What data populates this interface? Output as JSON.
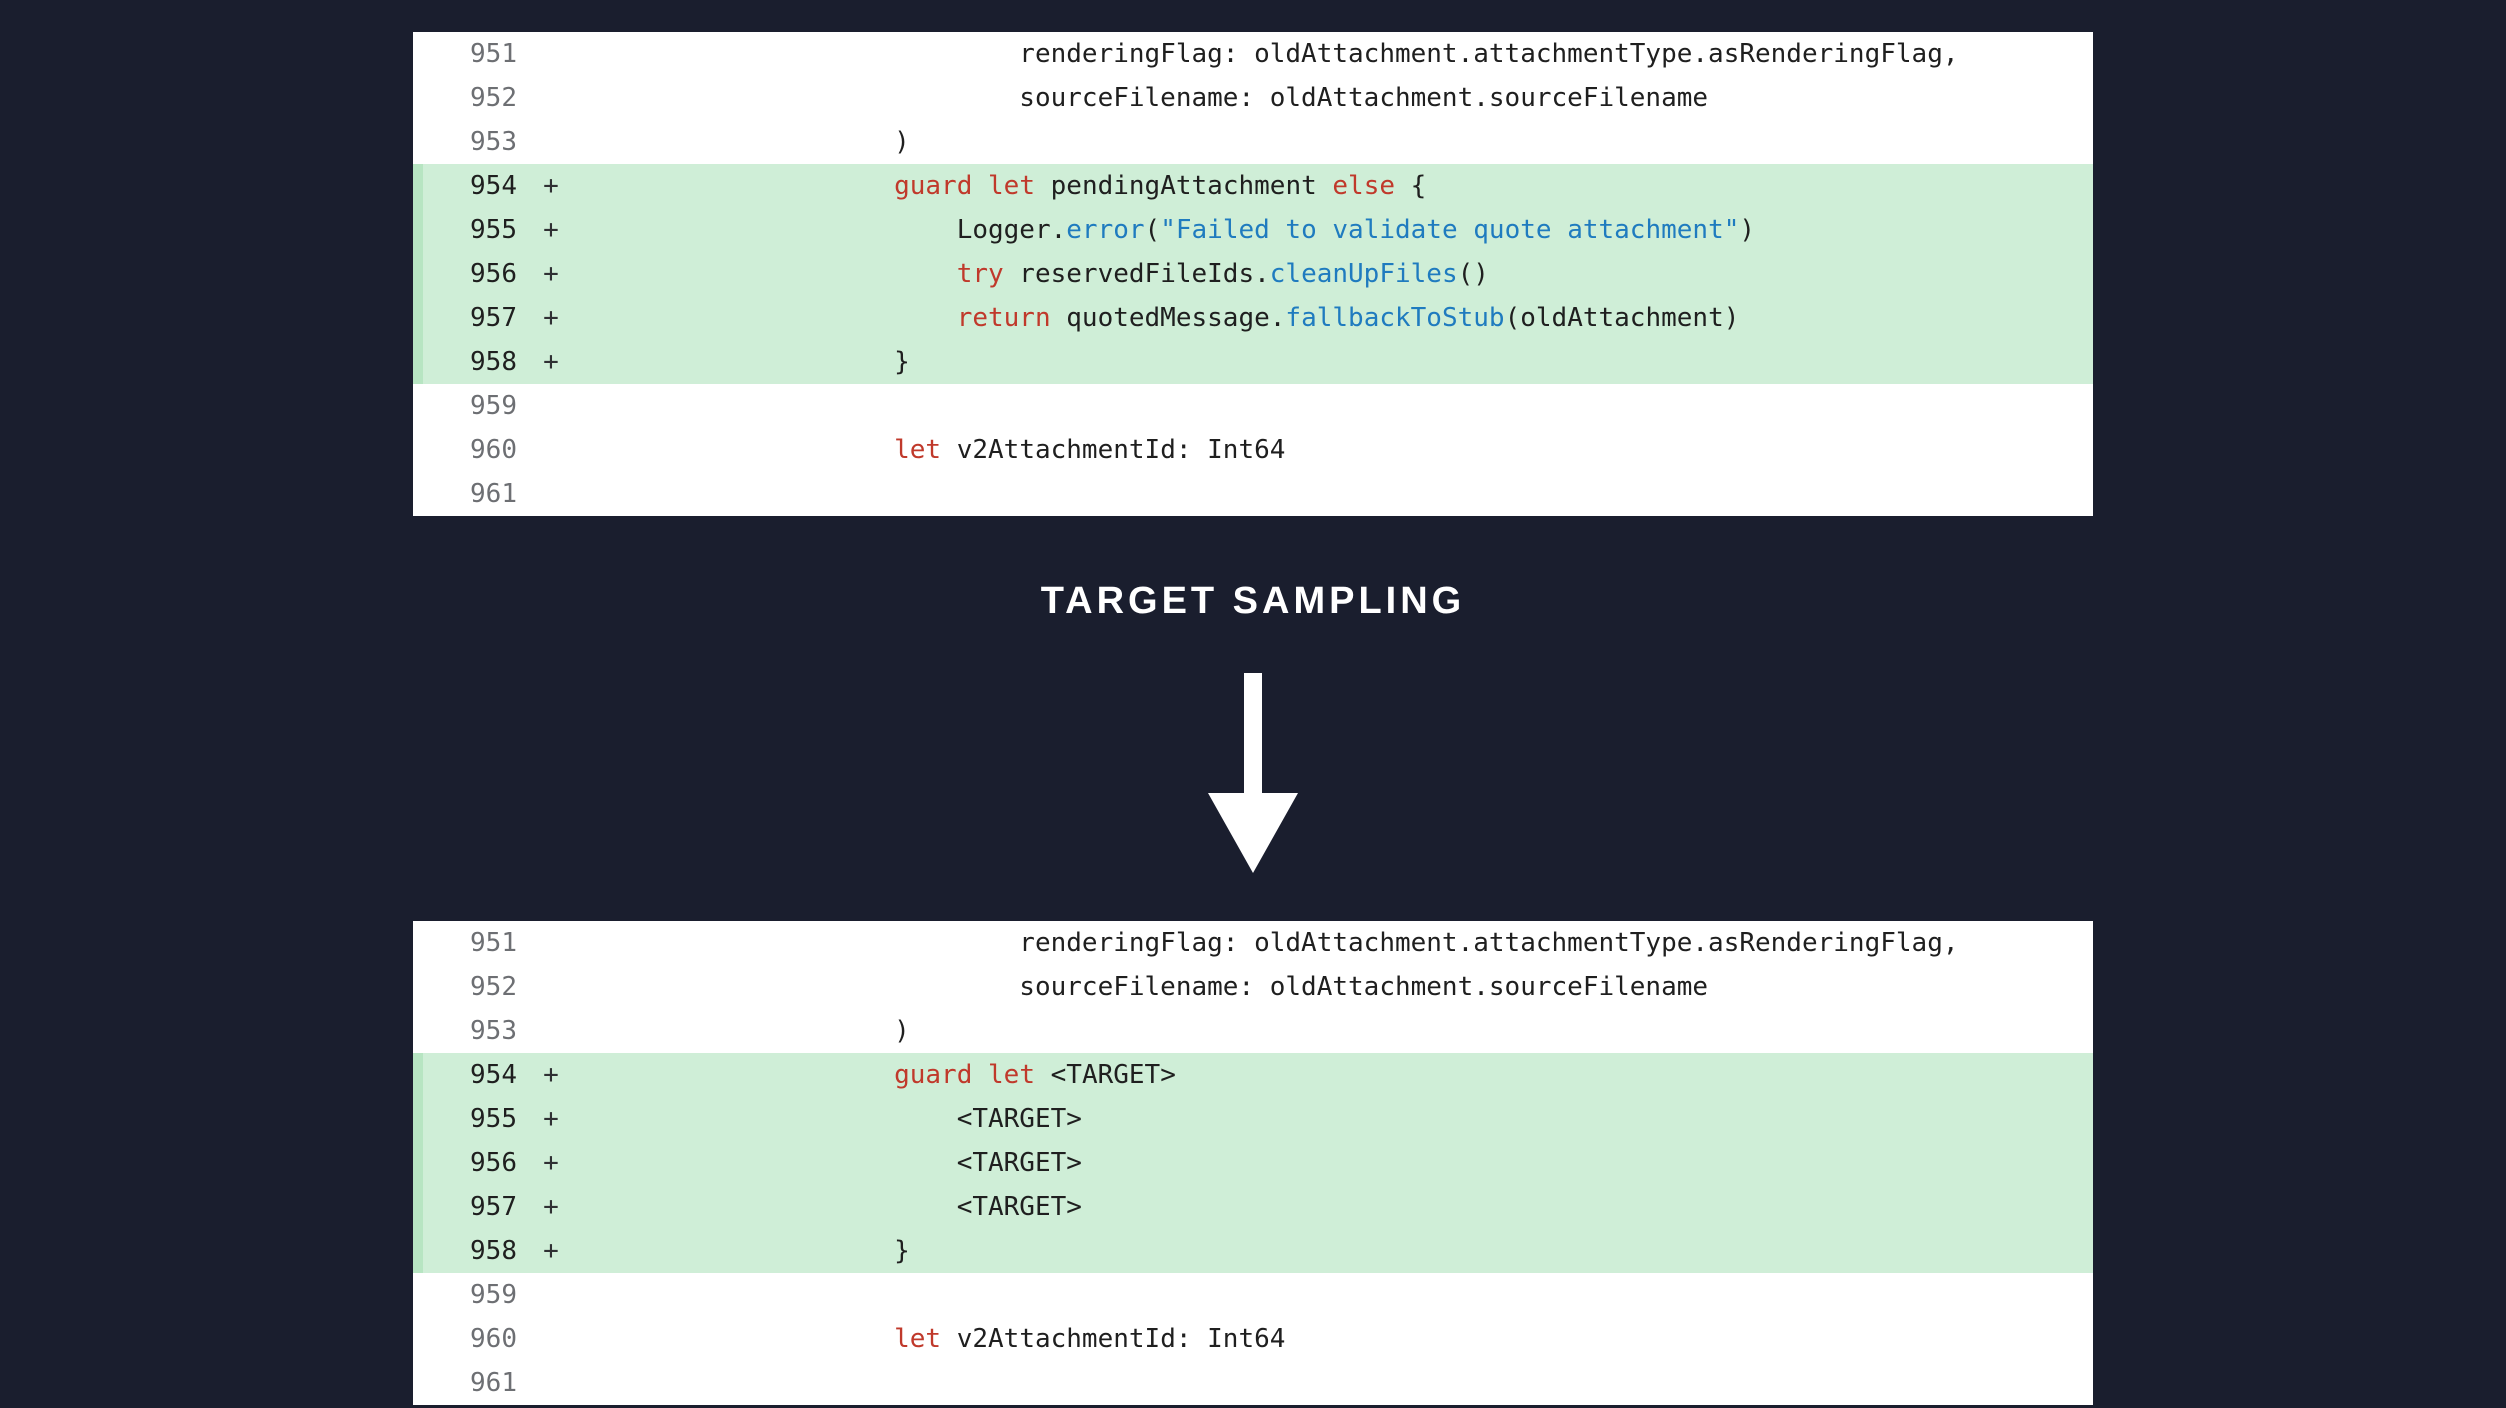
{
  "heading": "TARGET SAMPLING",
  "indent_unit": "    ",
  "top_block": {
    "lines": [
      {
        "num": "951",
        "op": "",
        "added": false,
        "indent": 7,
        "tokens": [
          {
            "t": "renderingFlag: oldAttachment.attachmentType.asRenderingFlag,",
            "c": ""
          }
        ]
      },
      {
        "num": "952",
        "op": "",
        "added": false,
        "indent": 7,
        "tokens": [
          {
            "t": "sourceFilename: oldAttachment.sourceFilename",
            "c": ""
          }
        ]
      },
      {
        "num": "953",
        "op": "",
        "added": false,
        "indent": 5,
        "tokens": [
          {
            "t": ")",
            "c": ""
          }
        ]
      },
      {
        "num": "954",
        "op": "+",
        "added": true,
        "indent": 5,
        "tokens": [
          {
            "t": "guard",
            "c": "kw"
          },
          {
            "t": " ",
            "c": ""
          },
          {
            "t": "let",
            "c": "kw"
          },
          {
            "t": " pendingAttachment ",
            "c": ""
          },
          {
            "t": "else",
            "c": "kw"
          },
          {
            "t": " {",
            "c": ""
          }
        ]
      },
      {
        "num": "955",
        "op": "+",
        "added": true,
        "indent": 6,
        "tokens": [
          {
            "t": "Logger.",
            "c": ""
          },
          {
            "t": "error",
            "c": "call"
          },
          {
            "t": "(",
            "c": ""
          },
          {
            "t": "\"Failed to validate quote attachment\"",
            "c": "str"
          },
          {
            "t": ")",
            "c": ""
          }
        ]
      },
      {
        "num": "956",
        "op": "+",
        "added": true,
        "indent": 6,
        "tokens": [
          {
            "t": "try",
            "c": "kw"
          },
          {
            "t": " reservedFileIds.",
            "c": ""
          },
          {
            "t": "cleanUpFiles",
            "c": "call"
          },
          {
            "t": "()",
            "c": ""
          }
        ]
      },
      {
        "num": "957",
        "op": "+",
        "added": true,
        "indent": 6,
        "tokens": [
          {
            "t": "return",
            "c": "kw"
          },
          {
            "t": " quotedMessage.",
            "c": ""
          },
          {
            "t": "fallbackToStub",
            "c": "call"
          },
          {
            "t": "(oldAttachment)",
            "c": ""
          }
        ]
      },
      {
        "num": "958",
        "op": "+",
        "added": true,
        "indent": 5,
        "tokens": [
          {
            "t": "}",
            "c": ""
          }
        ]
      },
      {
        "num": "959",
        "op": "",
        "added": false,
        "indent": 0,
        "tokens": [
          {
            "t": "",
            "c": ""
          }
        ]
      },
      {
        "num": "960",
        "op": "",
        "added": false,
        "indent": 5,
        "tokens": [
          {
            "t": "let",
            "c": "kw"
          },
          {
            "t": " v2AttachmentId: Int64",
            "c": ""
          }
        ]
      },
      {
        "num": "961",
        "op": "",
        "added": false,
        "indent": 0,
        "tokens": [
          {
            "t": "",
            "c": ""
          }
        ]
      }
    ]
  },
  "bottom_block": {
    "lines": [
      {
        "num": "951",
        "op": "",
        "added": false,
        "indent": 7,
        "tokens": [
          {
            "t": "renderingFlag: oldAttachment.attachmentType.asRenderingFlag,",
            "c": ""
          }
        ]
      },
      {
        "num": "952",
        "op": "",
        "added": false,
        "indent": 7,
        "tokens": [
          {
            "t": "sourceFilename: oldAttachment.sourceFilename",
            "c": ""
          }
        ]
      },
      {
        "num": "953",
        "op": "",
        "added": false,
        "indent": 5,
        "tokens": [
          {
            "t": ")",
            "c": ""
          }
        ]
      },
      {
        "num": "954",
        "op": "+",
        "added": true,
        "indent": 5,
        "tokens": [
          {
            "t": "guard",
            "c": "kw"
          },
          {
            "t": " ",
            "c": ""
          },
          {
            "t": "let",
            "c": "kw"
          },
          {
            "t": " <TARGET>",
            "c": ""
          }
        ]
      },
      {
        "num": "955",
        "op": "+",
        "added": true,
        "indent": 6,
        "tokens": [
          {
            "t": "<TARGET>",
            "c": ""
          }
        ]
      },
      {
        "num": "956",
        "op": "+",
        "added": true,
        "indent": 6,
        "tokens": [
          {
            "t": "<TARGET>",
            "c": ""
          }
        ]
      },
      {
        "num": "957",
        "op": "+",
        "added": true,
        "indent": 6,
        "tokens": [
          {
            "t": "<TARGET>",
            "c": ""
          }
        ]
      },
      {
        "num": "958",
        "op": "+",
        "added": true,
        "indent": 5,
        "tokens": [
          {
            "t": "}",
            "c": ""
          }
        ]
      },
      {
        "num": "959",
        "op": "",
        "added": false,
        "indent": 0,
        "tokens": [
          {
            "t": "",
            "c": ""
          }
        ]
      },
      {
        "num": "960",
        "op": "",
        "added": false,
        "indent": 5,
        "tokens": [
          {
            "t": "let",
            "c": "kw"
          },
          {
            "t": " v2AttachmentId: Int64",
            "c": ""
          }
        ]
      },
      {
        "num": "961",
        "op": "",
        "added": false,
        "indent": 0,
        "tokens": [
          {
            "t": "",
            "c": ""
          }
        ]
      }
    ]
  }
}
